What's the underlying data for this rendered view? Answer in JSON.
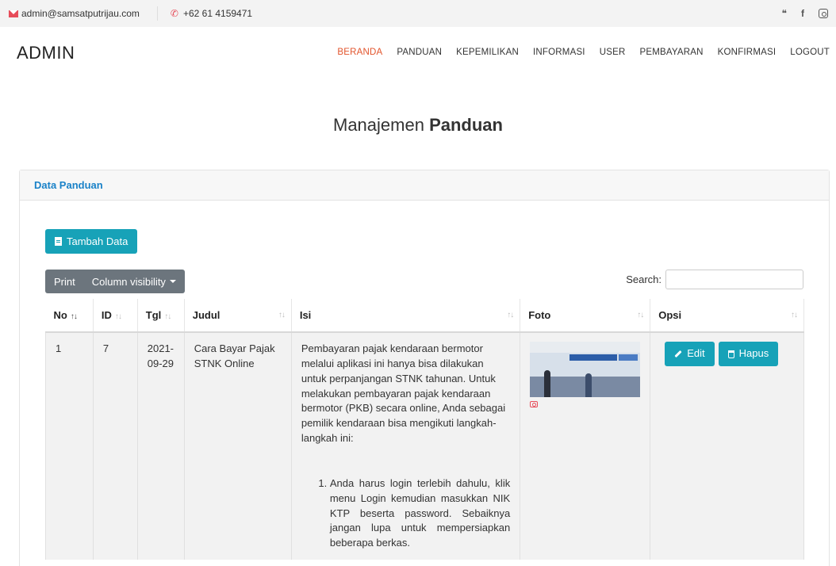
{
  "topbar": {
    "email": "admin@samsatputrijau.com",
    "phone": "+62 61 4159471",
    "social": [
      "twitter-icon",
      "facebook-icon",
      "instagram-icon"
    ]
  },
  "navbar": {
    "brand": "ADMIN",
    "menu": [
      "BERANDA",
      "PANDUAN",
      "KEPEMILIKAN",
      "INFORMASI",
      "USER",
      "PEMBAYARAN",
      "KONFIRMASI",
      "LOGOUT"
    ],
    "active": "BERANDA"
  },
  "page": {
    "title_prefix": "Manajemen",
    "title_bold": "Panduan"
  },
  "card": {
    "header": "Data Panduan",
    "add_button": "Tambah Data",
    "print_button": "Print",
    "colvis_button": "Column visibility",
    "search_label": "Search:",
    "search_value": ""
  },
  "table": {
    "columns": [
      "No",
      "ID",
      "Tgl",
      "Judul",
      "Isi",
      "Foto",
      "Opsi"
    ],
    "rows": [
      {
        "no": "1",
        "id": "7",
        "tgl_line1": "2021-",
        "tgl_line2": "09-29",
        "judul": "Cara Bayar Pajak STNK Online",
        "isi_para": "Pembayaran pajak kendaraan bermotor melalui aplikasi ini hanya bisa dilakukan untuk perpanjangan STNK tahunan. Untuk melakukan pembayaran pajak kendaraan bermotor (PKB) secara online, Anda sebagai pemilik kendaraan bisa mengikuti langkah-langkah ini:",
        "isi_list_1": "Anda harus login terlebih dahulu, klik menu Login kemudian masukkan NIK KTP beserta password. Sebaiknya jangan lupa untuk mempersiapkan beberapa berkas.",
        "edit_button": "Edit",
        "delete_button": "Hapus"
      }
    ]
  },
  "colors": {
    "accent": "#17a2b8",
    "active_nav": "#e2542c",
    "header_link": "#1a82c8",
    "secondary": "#6c757d"
  }
}
